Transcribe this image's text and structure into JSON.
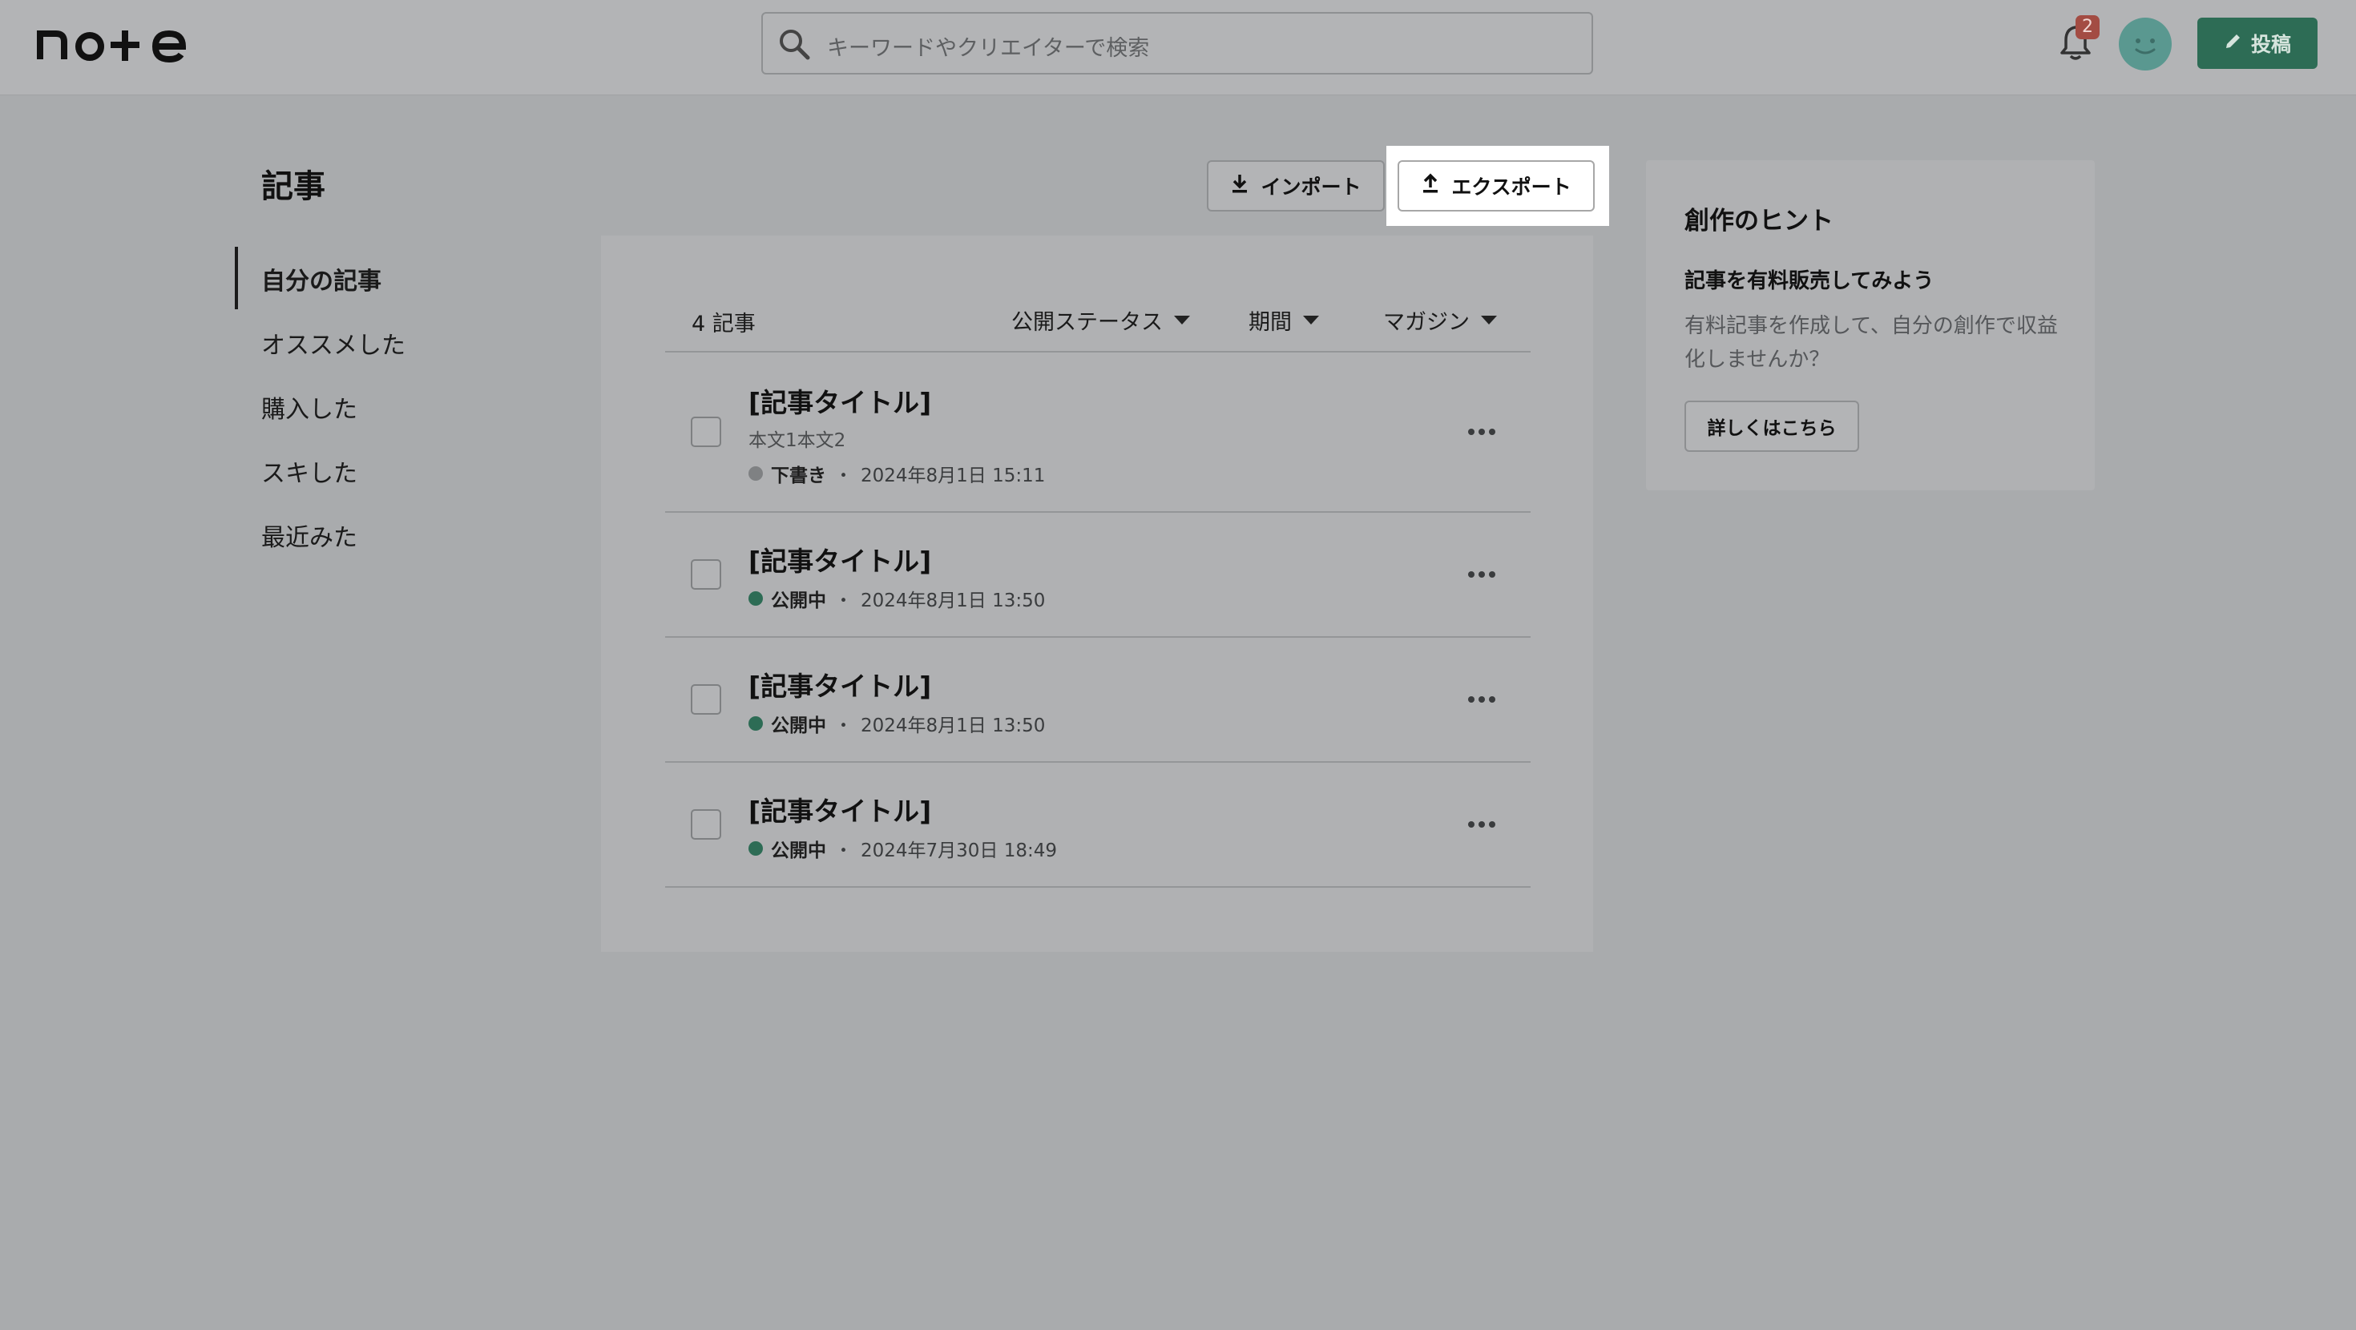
{
  "header": {
    "logo_text": "note",
    "search_placeholder": "キーワードやクリエイターで検索",
    "notification_count": "2",
    "post_label": "投稿"
  },
  "page": {
    "title": "記事",
    "import_label": "インポート",
    "export_label": "エクスポート"
  },
  "sidebar": {
    "items": [
      {
        "label": "自分の記事",
        "active": true
      },
      {
        "label": "オススメした"
      },
      {
        "label": "購入した"
      },
      {
        "label": "スキした"
      },
      {
        "label": "最近みた"
      }
    ]
  },
  "list": {
    "count_label": "4 記事",
    "filters": [
      "公開ステータス",
      "期間",
      "マガジン"
    ],
    "articles": [
      {
        "title": "[記事タイトル]",
        "body": "本文1本文2",
        "status": "下書き",
        "date": "2024年8月1日 15:11",
        "status_color": "#7f8183"
      },
      {
        "title": "[記事タイトル]",
        "status": "公開中",
        "date": "2024年8月1日 13:50",
        "status_color": "#2d6c55"
      },
      {
        "title": "[記事タイトル]",
        "status": "公開中",
        "date": "2024年8月1日 13:50",
        "status_color": "#2d6c55"
      },
      {
        "title": "[記事タイトル]",
        "status": "公開中",
        "date": "2024年7月30日 18:49",
        "status_color": "#2d6c55"
      }
    ],
    "separator": "・"
  },
  "hint": {
    "title": "創作のヒント",
    "subtitle": "記事を有料販売してみよう",
    "description": "有料記事を作成して、自分の創作で収益化しませんか？",
    "button_label": "詳しくはこちら"
  },
  "colors": {
    "brand": "#2d6c55",
    "badge": "#a34c43",
    "overlay_bg": "#a9abad"
  }
}
